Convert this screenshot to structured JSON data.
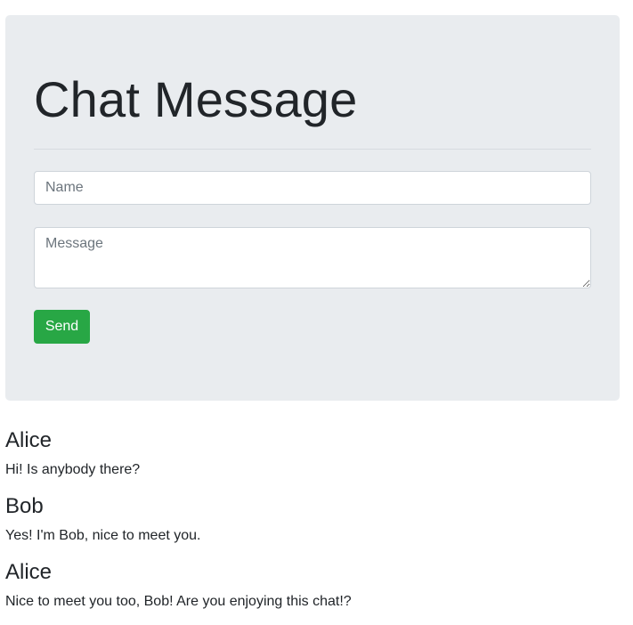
{
  "form": {
    "title": "Chat Message",
    "name_placeholder": "Name",
    "message_placeholder": "Message",
    "send_label": "Send"
  },
  "messages": [
    {
      "sender": "Alice",
      "text": "Hi! Is anybody there?"
    },
    {
      "sender": "Bob",
      "text": "Yes! I'm Bob, nice to meet you."
    },
    {
      "sender": "Alice",
      "text": "Nice to meet you too, Bob! Are you enjoying this chat!?"
    }
  ],
  "colors": {
    "panel_background": "#e9ecef",
    "send_button": "#28a745"
  }
}
